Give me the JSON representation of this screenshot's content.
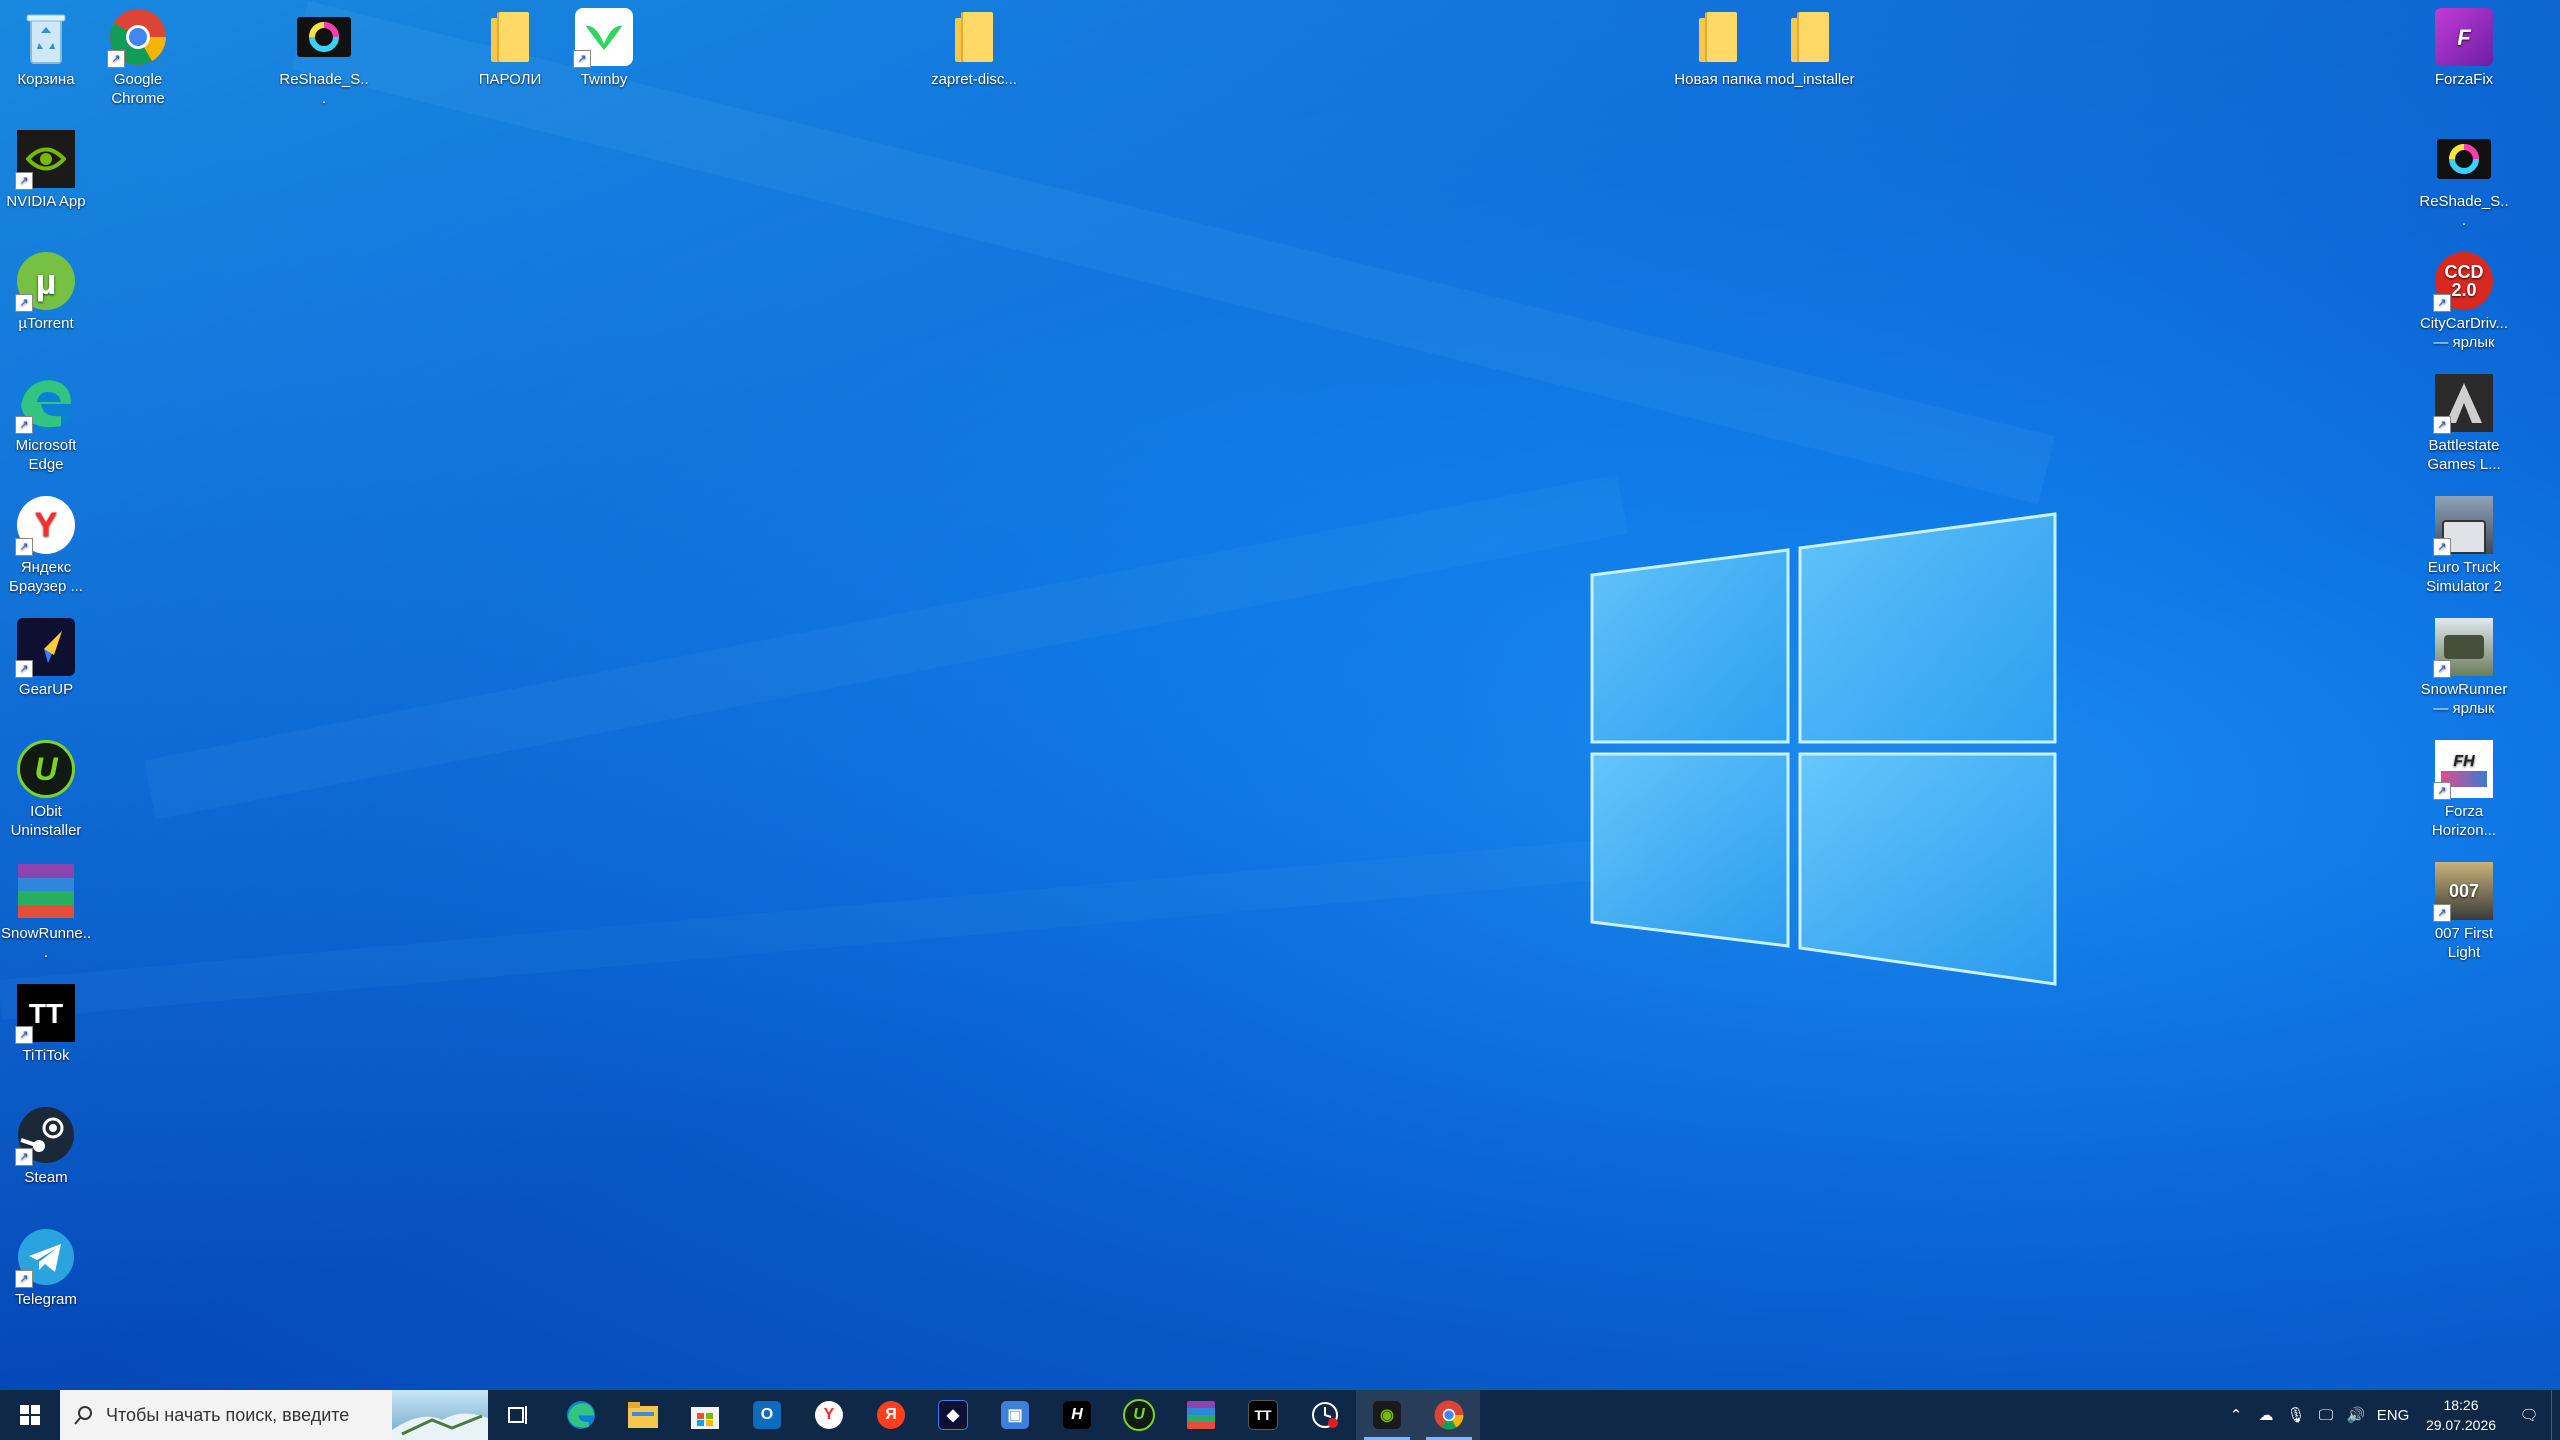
{
  "desktop_icons": [
    {
      "label": "Корзина",
      "icon": "recycle-bin-icon"
    },
    {
      "label": "Google Chrome",
      "icon": "chrome-icon"
    },
    {
      "label": "ReShade_S...",
      "icon": "reshade-icon"
    },
    {
      "label": "ПАРОЛИ",
      "icon": "folder-icon"
    },
    {
      "label": "Twinby",
      "icon": "twinby-icon"
    },
    {
      "label": "zapret-disc...",
      "icon": "folder-icon"
    },
    {
      "label": "Новая папка",
      "icon": "folder-icon"
    },
    {
      "label": "mod_installer",
      "icon": "folder-icon"
    },
    {
      "label": "ForzaFix",
      "icon": "forzafix-icon"
    },
    {
      "label": "NVIDIA App",
      "icon": "nvidia-icon"
    },
    {
      "label": "µTorrent",
      "icon": "utorrent-icon"
    },
    {
      "label": "Microsoft Edge",
      "icon": "edge-icon"
    },
    {
      "label": "Яндекс Браузер ...",
      "icon": "yandex-browser-icon"
    },
    {
      "label": "GearUP",
      "icon": "gearup-icon"
    },
    {
      "label": "IObit Uninstaller",
      "icon": "iobit-icon"
    },
    {
      "label": "SnowRunne...",
      "icon": "winrar-icon"
    },
    {
      "label": "TiTiTok",
      "icon": "tititok-icon"
    },
    {
      "label": "Steam",
      "icon": "steam-icon"
    },
    {
      "label": "Telegram",
      "icon": "telegram-icon"
    },
    {
      "label": "ReShade_S...",
      "icon": "reshade-icon"
    },
    {
      "label": "CityCarDriv... — ярлык",
      "icon": "citycar-icon"
    },
    {
      "label": "Battlestate Games L...",
      "icon": "battlestate-icon"
    },
    {
      "label": "Euro Truck Simulator 2",
      "icon": "ets2-icon"
    },
    {
      "label": "SnowRunner — ярлык",
      "icon": "snowrunner-icon"
    },
    {
      "label": "Forza Horizon...",
      "icon": "forza-horizon-icon"
    },
    {
      "label": "007 First Light",
      "icon": "007-icon"
    }
  ],
  "taskbar": {
    "search_placeholder": "Чтобы начать поиск, введите",
    "pinned": [
      "task-view",
      "edge",
      "file-explorer",
      "microsoft-store",
      "outlook",
      "yandex-browser",
      "yandex",
      "gearup",
      "control-panel",
      "hitman",
      "iobit",
      "winrar",
      "tititok",
      "clock-app",
      "nvidia",
      "chrome"
    ]
  },
  "tray": {
    "language": "ENG",
    "time": "18:26",
    "date": "29.07.2026"
  },
  "colors": {
    "taskbar": "#102848",
    "accent": "#0a5fd0",
    "folder": "#ffd966"
  }
}
